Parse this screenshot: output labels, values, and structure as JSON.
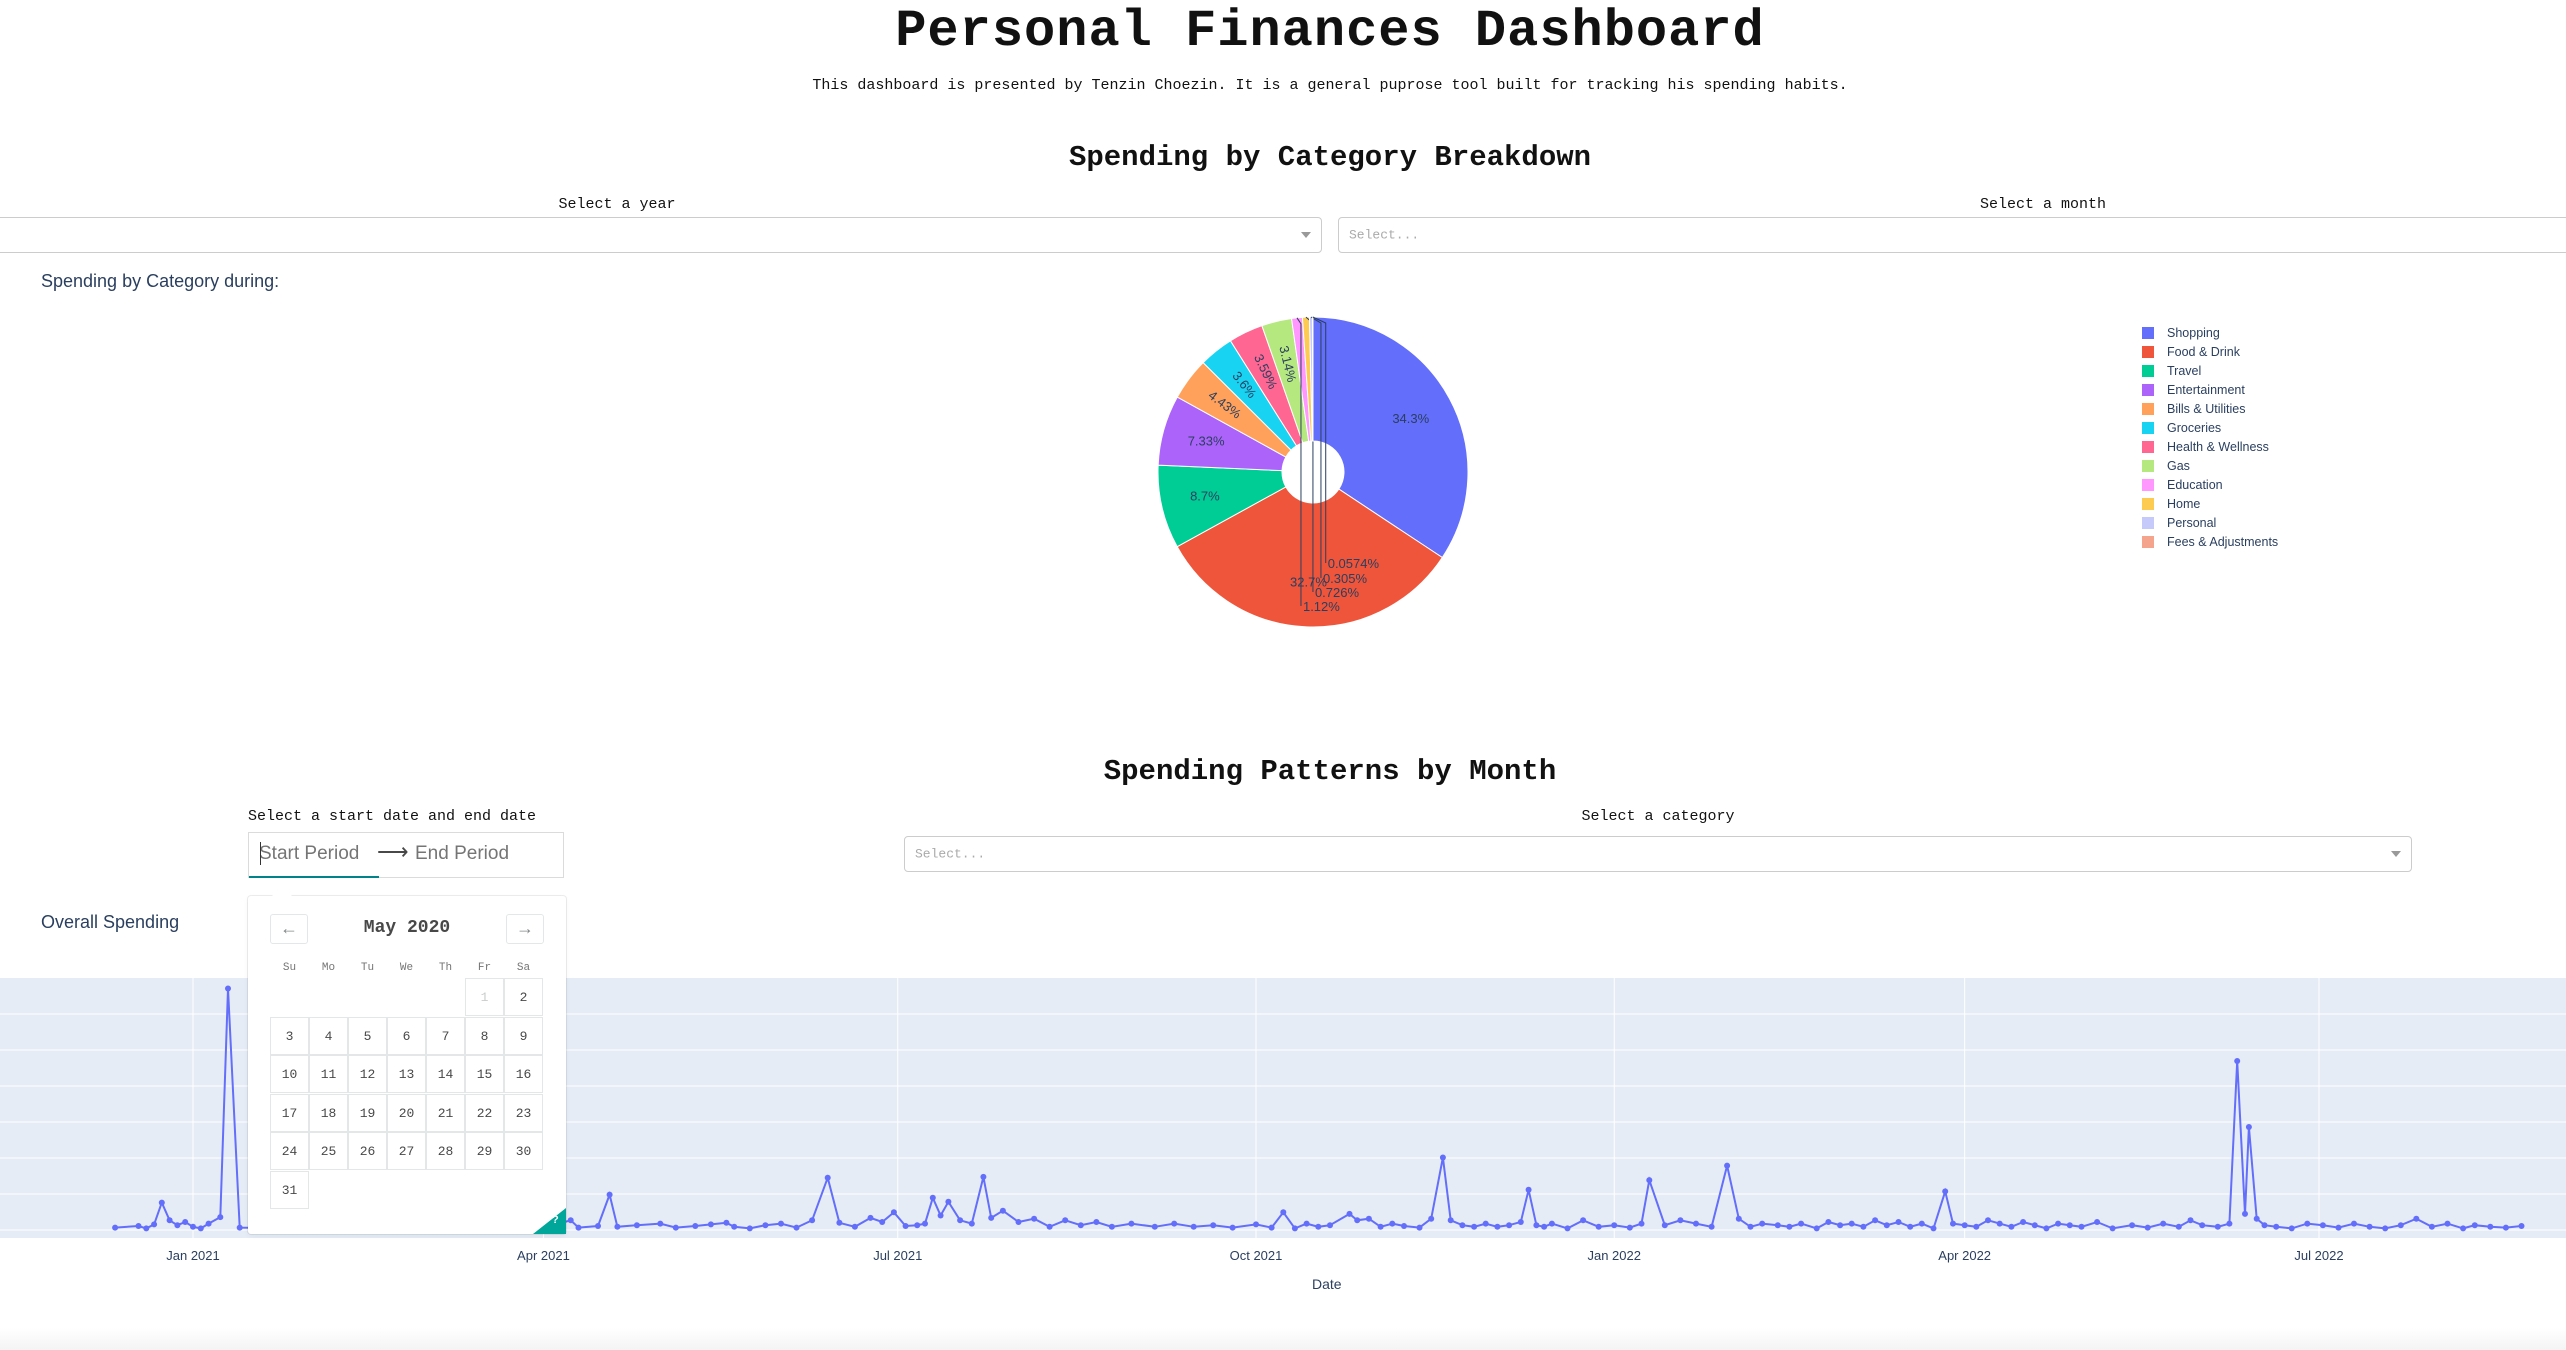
{
  "header": {
    "title": "Personal Finances Dashboard",
    "subtitle": "This dashboard is presented by Tenzin Choezin. It is a general puprose tool built for tracking his spending habits."
  },
  "category_section": {
    "title": "Spending by Category Breakdown",
    "year_label": "Select a year",
    "year_value": "",
    "month_label": "Select a month",
    "month_placeholder": "Select...",
    "graph_heading": "Spending by Category during:"
  },
  "patterns_section": {
    "title": "Spending Patterns by Month",
    "date_label": "Select a start date and end date",
    "start_placeholder": "Start Period",
    "end_placeholder": "End Period",
    "arrow": "⟶",
    "category_label": "Select a category",
    "category_placeholder": "Select...",
    "graph_heading": "Overall Spending"
  },
  "calendar": {
    "month_label": "May 2020",
    "prev": "←",
    "next": "→",
    "weekdays": [
      "Su",
      "Mo",
      "Tu",
      "We",
      "Th",
      "Fr",
      "Sa"
    ],
    "blocked_day": "1",
    "corner_badge": "?"
  },
  "colors": {
    "plot_bg": "#e5ecf6",
    "line": "#636efa"
  },
  "chart_data": [
    {
      "type": "pie",
      "hole": true,
      "categories": [
        "Shopping",
        "Food & Drink",
        "Travel",
        "Entertainment",
        "Bills & Utilities",
        "Groceries",
        "Health & Wellness",
        "Gas",
        "Education",
        "Home",
        "Personal",
        "Fees & Adjustments"
      ],
      "values": [
        34.3,
        32.7,
        8.7,
        7.33,
        4.43,
        3.6,
        3.59,
        3.14,
        1.12,
        0.726,
        0.305,
        0.0574
      ],
      "labels": [
        "34.3%",
        "32.7%",
        "8.7%",
        "7.33%",
        "4.43%",
        "3.6%",
        "3.59%",
        "3.14%",
        "1.12%",
        "0.726%",
        "0.305%",
        "0.0574%"
      ],
      "colors": [
        "#636efa",
        "#ef553b",
        "#00cc96",
        "#ab63fa",
        "#ffa15a",
        "#19d3f3",
        "#ff6692",
        "#b6e880",
        "#ff97ff",
        "#fecb52",
        "#c6cafa",
        "#f4a38d"
      ],
      "legend_placement": "right"
    },
    {
      "type": "line",
      "xlabel": "Date",
      "ylabel": "",
      "x_ticks": [
        "Jan 2021",
        "Apr 2021",
        "Jul 2021",
        "Oct 2021",
        "Jan 2022",
        "Apr 2022",
        "Jul 2022"
      ],
      "grid": true,
      "series": [
        {
          "points": [
            [
              "2020-12-12",
              3
            ],
            [
              "2020-12-18",
              5
            ],
            [
              "2020-12-20",
              2
            ],
            [
              "2020-12-22",
              7
            ],
            [
              "2020-12-24",
              34
            ],
            [
              "2020-12-26",
              12
            ],
            [
              "2020-12-28",
              6
            ],
            [
              "2020-12-30",
              10
            ],
            [
              "2021-01-01",
              4
            ],
            [
              "2021-01-03",
              2
            ],
            [
              "2021-01-05",
              8
            ],
            [
              "2021-01-08",
              16
            ],
            [
              "2021-01-10",
              300
            ],
            [
              "2021-01-13",
              3
            ],
            [
              "2021-02-01",
              2
            ],
            [
              "2021-02-10",
              1
            ],
            [
              "2021-02-20",
              2
            ],
            [
              "2021-03-01",
              1
            ],
            [
              "2021-03-10",
              2
            ],
            [
              "2021-03-20",
              1
            ],
            [
              "2021-03-28",
              3
            ],
            [
              "2021-04-02",
              4
            ],
            [
              "2021-04-05",
              8
            ],
            [
              "2021-04-08",
              12
            ],
            [
              "2021-04-10",
              3
            ],
            [
              "2021-04-15",
              5
            ],
            [
              "2021-04-18",
              44
            ],
            [
              "2021-04-20",
              4
            ],
            [
              "2021-04-25",
              6
            ],
            [
              "2021-05-01",
              8
            ],
            [
              "2021-05-05",
              3
            ],
            [
              "2021-05-10",
              5
            ],
            [
              "2021-05-14",
              7
            ],
            [
              "2021-05-18",
              9
            ],
            [
              "2021-05-20",
              4
            ],
            [
              "2021-05-24",
              2
            ],
            [
              "2021-05-28",
              6
            ],
            [
              "2021-06-01",
              8
            ],
            [
              "2021-06-05",
              3
            ],
            [
              "2021-06-09",
              12
            ],
            [
              "2021-06-13",
              65
            ],
            [
              "2021-06-16",
              9
            ],
            [
              "2021-06-20",
              4
            ],
            [
              "2021-06-24",
              15
            ],
            [
              "2021-06-27",
              10
            ],
            [
              "2021-06-30",
              22
            ],
            [
              "2021-07-03",
              5
            ],
            [
              "2021-07-06",
              6
            ],
            [
              "2021-07-08",
              8
            ],
            [
              "2021-07-10",
              40
            ],
            [
              "2021-07-12",
              18
            ],
            [
              "2021-07-14",
              35
            ],
            [
              "2021-07-17",
              12
            ],
            [
              "2021-07-20",
              8
            ],
            [
              "2021-07-23",
              66
            ],
            [
              "2021-07-25",
              15
            ],
            [
              "2021-07-28",
              24
            ],
            [
              "2021-08-01",
              10
            ],
            [
              "2021-08-05",
              14
            ],
            [
              "2021-08-09",
              4
            ],
            [
              "2021-08-13",
              12
            ],
            [
              "2021-08-17",
              6
            ],
            [
              "2021-08-21",
              10
            ],
            [
              "2021-08-25",
              4
            ],
            [
              "2021-08-30",
              8
            ],
            [
              "2021-09-05",
              4
            ],
            [
              "2021-09-10",
              8
            ],
            [
              "2021-09-15",
              4
            ],
            [
              "2021-09-20",
              6
            ],
            [
              "2021-09-25",
              3
            ],
            [
              "2021-10-01",
              7
            ],
            [
              "2021-10-05",
              3
            ],
            [
              "2021-10-08",
              22
            ],
            [
              "2021-10-11",
              2
            ],
            [
              "2021-10-14",
              8
            ],
            [
              "2021-10-17",
              4
            ],
            [
              "2021-10-20",
              6
            ],
            [
              "2021-10-25",
              20
            ],
            [
              "2021-10-27",
              12
            ],
            [
              "2021-10-30",
              14
            ],
            [
              "2021-11-02",
              4
            ],
            [
              "2021-11-05",
              8
            ],
            [
              "2021-11-08",
              5
            ],
            [
              "2021-11-12",
              3
            ],
            [
              "2021-11-15",
              14
            ],
            [
              "2021-11-18",
              90
            ],
            [
              "2021-11-20",
              12
            ],
            [
              "2021-11-23",
              6
            ],
            [
              "2021-11-26",
              4
            ],
            [
              "2021-11-29",
              8
            ],
            [
              "2021-12-02",
              4
            ],
            [
              "2021-12-05",
              6
            ],
            [
              "2021-12-08",
              10
            ],
            [
              "2021-12-10",
              50
            ],
            [
              "2021-12-12",
              6
            ],
            [
              "2021-12-14",
              4
            ],
            [
              "2021-12-16",
              8
            ],
            [
              "2021-12-20",
              2
            ],
            [
              "2021-12-24",
              12
            ],
            [
              "2021-12-28",
              4
            ],
            [
              "2022-01-01",
              6
            ],
            [
              "2022-01-05",
              3
            ],
            [
              "2022-01-08",
              8
            ],
            [
              "2022-01-10",
              62
            ],
            [
              "2022-01-14",
              6
            ],
            [
              "2022-01-18",
              12
            ],
            [
              "2022-01-22",
              8
            ],
            [
              "2022-01-26",
              4
            ],
            [
              "2022-01-30",
              80
            ],
            [
              "2022-02-02",
              14
            ],
            [
              "2022-02-05",
              4
            ],
            [
              "2022-02-08",
              8
            ],
            [
              "2022-02-12",
              6
            ],
            [
              "2022-02-15",
              4
            ],
            [
              "2022-02-18",
              8
            ],
            [
              "2022-02-22",
              2
            ],
            [
              "2022-02-25",
              10
            ],
            [
              "2022-02-28",
              6
            ],
            [
              "2022-03-03",
              8
            ],
            [
              "2022-03-06",
              4
            ],
            [
              "2022-03-09",
              12
            ],
            [
              "2022-03-12",
              6
            ],
            [
              "2022-03-15",
              10
            ],
            [
              "2022-03-18",
              4
            ],
            [
              "2022-03-21",
              8
            ],
            [
              "2022-03-24",
              2
            ],
            [
              "2022-03-27",
              48
            ],
            [
              "2022-03-29",
              8
            ],
            [
              "2022-04-01",
              6
            ],
            [
              "2022-04-04",
              4
            ],
            [
              "2022-04-07",
              12
            ],
            [
              "2022-04-10",
              8
            ],
            [
              "2022-04-13",
              4
            ],
            [
              "2022-04-16",
              10
            ],
            [
              "2022-04-19",
              6
            ],
            [
              "2022-04-22",
              2
            ],
            [
              "2022-04-25",
              8
            ],
            [
              "2022-04-28",
              6
            ],
            [
              "2022-05-01",
              4
            ],
            [
              "2022-05-05",
              10
            ],
            [
              "2022-05-09",
              2
            ],
            [
              "2022-05-14",
              6
            ],
            [
              "2022-05-18",
              3
            ],
            [
              "2022-05-22",
              8
            ],
            [
              "2022-05-26",
              4
            ],
            [
              "2022-05-29",
              12
            ],
            [
              "2022-06-01",
              6
            ],
            [
              "2022-06-05",
              4
            ],
            [
              "2022-06-08",
              8
            ],
            [
              "2022-06-10",
              210
            ],
            [
              "2022-06-12",
              20
            ],
            [
              "2022-06-13",
              128
            ],
            [
              "2022-06-15",
              14
            ],
            [
              "2022-06-17",
              6
            ],
            [
              "2022-06-20",
              4
            ],
            [
              "2022-06-24",
              2
            ],
            [
              "2022-06-28",
              8
            ],
            [
              "2022-07-02",
              6
            ],
            [
              "2022-07-06",
              3
            ],
            [
              "2022-07-10",
              8
            ],
            [
              "2022-07-14",
              4
            ],
            [
              "2022-07-18",
              2
            ],
            [
              "2022-07-22",
              6
            ],
            [
              "2022-07-26",
              14
            ],
            [
              "2022-07-30",
              4
            ],
            [
              "2022-08-03",
              8
            ],
            [
              "2022-08-07",
              2
            ],
            [
              "2022-08-10",
              6
            ],
            [
              "2022-08-14",
              4
            ],
            [
              "2022-08-18",
              3
            ],
            [
              "2022-08-22",
              5
            ]
          ]
        }
      ]
    }
  ]
}
